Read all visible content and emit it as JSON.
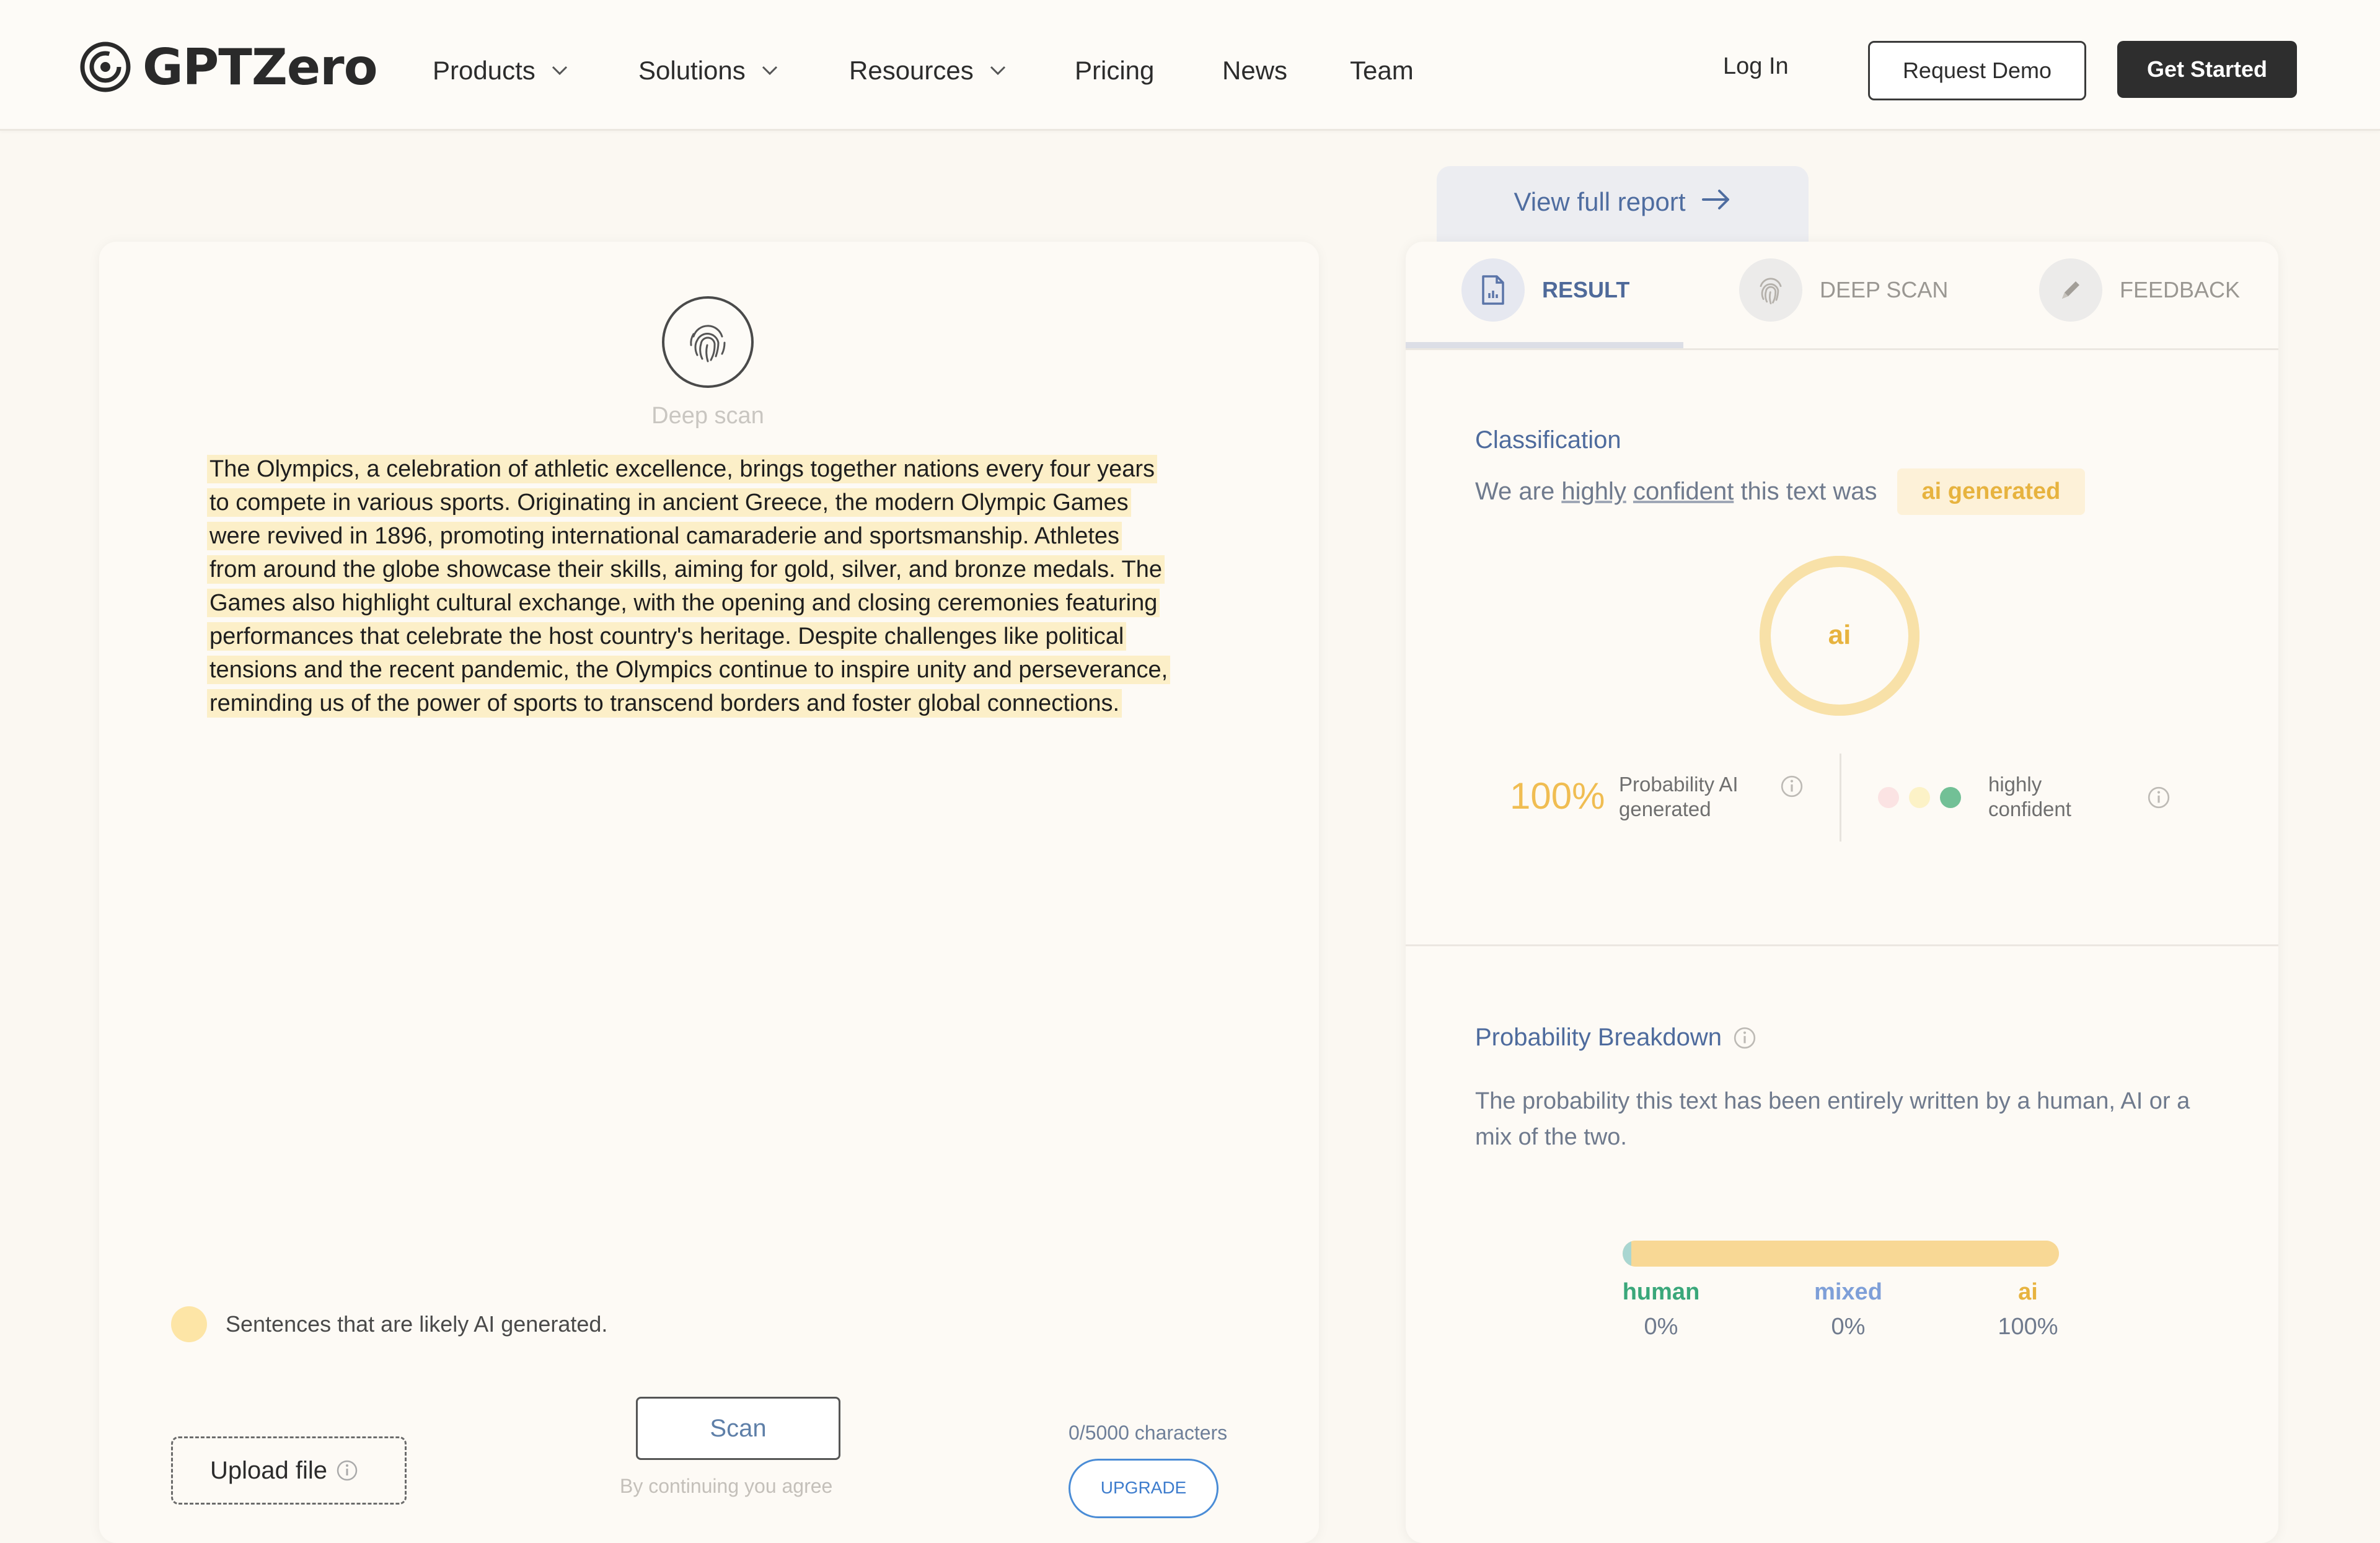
{
  "header": {
    "logo_text": "GPTZero",
    "nav": [
      {
        "label": "Products",
        "dropdown": true
      },
      {
        "label": "Solutions",
        "dropdown": true
      },
      {
        "label": "Resources",
        "dropdown": true
      },
      {
        "label": "Pricing",
        "dropdown": false
      },
      {
        "label": "News",
        "dropdown": false
      },
      {
        "label": "Team",
        "dropdown": false
      }
    ],
    "login_label": "Log In",
    "demo_label": "Request Demo",
    "start_label": "Get Started"
  },
  "editor": {
    "deep_scan_label": "Deep scan",
    "essay_lines": [
      "The Olympics, a celebration of athletic excellence, brings together nations every four years",
      "to compete in various sports. Originating in ancient Greece, the modern Olympic Games",
      "were revived in 1896, promoting international camaraderie and sportsmanship. Athletes",
      "from around the globe showcase their skills, aiming for gold, silver, and bronze medals. The",
      "Games also highlight cultural exchange, with the opening and closing ceremonies featuring",
      "performances that celebrate the host country's heritage. Despite challenges like political",
      "tensions and the recent pandemic, the Olympics continue to inspire unity and perseverance,",
      "reminding us of the power of sports to transcend borders and foster global connections."
    ],
    "legend_text": "Sentences that are likely AI generated.",
    "upload_label": "Upload file",
    "scan_label": "Scan",
    "agree_text": "By continuing you agree",
    "char_count": "0/5000 characters",
    "upgrade_label": "UPGRADE"
  },
  "results": {
    "view_report_label": "View full report",
    "tabs": [
      {
        "label": "RESULT",
        "icon": "document-chart-icon",
        "active": true
      },
      {
        "label": "DEEP SCAN",
        "icon": "fingerprint-icon",
        "active": false
      },
      {
        "label": "FEEDBACK",
        "icon": "pencil-icon",
        "active": false
      }
    ],
    "classification_title": "Classification",
    "class_prefix": "We are",
    "class_word1": "highly",
    "class_word2": "confident",
    "class_mid": "this text was",
    "class_badge": "ai generated",
    "ring_label": "ai",
    "ai_probability": "100%",
    "ai_probability_value": 1.0,
    "probability_label_l1": "Probability AI",
    "probability_label_l2": "generated",
    "confidence_label_l1": "highly",
    "confidence_label_l2": "confident",
    "confidence_colors": [
      "#fbe3e3",
      "#fcf2c7",
      "#72c096"
    ],
    "breakdown_title": "Probability Breakdown",
    "breakdown_desc": "The probability this text has been entirely written by a human, AI or a mix of the two.",
    "breakdown": [
      {
        "label": "human",
        "value": "0%",
        "fraction": 0.0,
        "color": "#3aa77a"
      },
      {
        "label": "mixed",
        "value": "0%",
        "fraction": 0.0,
        "color": "#7e9fd8"
      },
      {
        "label": "ai",
        "value": "100%",
        "fraction": 1.0,
        "color": "#e7b33f"
      }
    ]
  },
  "colors": {
    "accent_ai": "#e7b33f",
    "highlight": "#fcefc8",
    "primary_blue": "#4f6da0"
  }
}
